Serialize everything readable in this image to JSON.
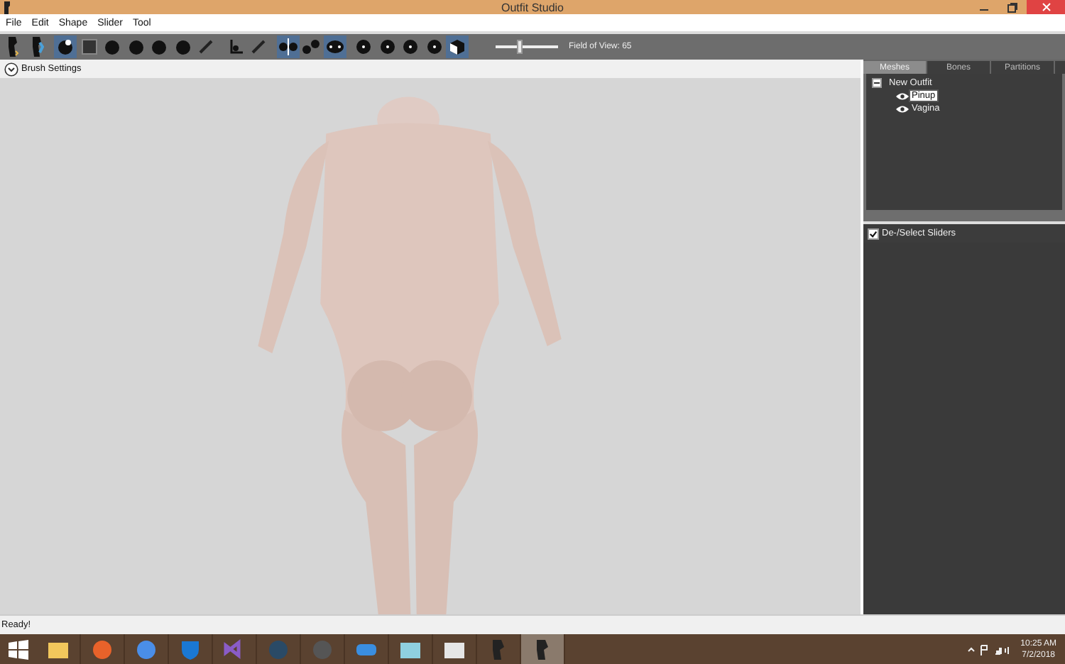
{
  "window": {
    "title": "Outfit Studio"
  },
  "menu": [
    "File",
    "Edit",
    "Shape",
    "Slider",
    "Tool"
  ],
  "toolbar": {
    "tools": [
      {
        "kind": "figure",
        "selected": false
      },
      {
        "kind": "figure",
        "selected": false
      },
      {
        "kind": "sphere",
        "selected": true
      },
      {
        "kind": "square",
        "selected": false
      },
      {
        "kind": "sphere",
        "selected": false
      },
      {
        "kind": "sphere",
        "selected": false
      },
      {
        "kind": "sphere",
        "selected": false
      },
      {
        "kind": "sphere",
        "selected": false
      },
      {
        "kind": "pen",
        "selected": false
      },
      {
        "kind": "axes",
        "selected": false
      },
      {
        "kind": "pen",
        "selected": false
      },
      {
        "kind": "mirror",
        "selected": true
      },
      {
        "kind": "dots",
        "selected": false
      },
      {
        "kind": "dots",
        "selected": true
      },
      {
        "kind": "dot",
        "selected": false
      },
      {
        "kind": "dot",
        "selected": false
      },
      {
        "kind": "dot",
        "selected": false
      },
      {
        "kind": "dot",
        "selected": false
      },
      {
        "kind": "cube",
        "selected": true
      }
    ],
    "fov_slider": {
      "level": 0.4
    },
    "fov_label": "Field of View: 65"
  },
  "brush_settings": {
    "label": "Brush Settings",
    "expanded": false
  },
  "panel": {
    "tabs": [
      {
        "label": "Meshes",
        "selected": true
      },
      {
        "label": "Bones",
        "selected": false
      },
      {
        "label": "Partitions",
        "selected": false
      }
    ],
    "tree": {
      "label": "New Outfit",
      "children": [
        {
          "label": "Pinup",
          "selected": true
        },
        {
          "label": "Vagina",
          "selected": false
        }
      ]
    },
    "sliders_toggle": {
      "label": "De-/Select Sliders",
      "checked": true
    }
  },
  "status_bar": "Ready!",
  "taskbar": {
    "apps": [
      {
        "selected": false
      },
      {
        "selected": false
      },
      {
        "selected": false
      },
      {
        "selected": false
      },
      {
        "selected": false
      },
      {
        "selected": false
      },
      {
        "selected": false
      },
      {
        "selected": false
      },
      {
        "selected": false
      },
      {
        "selected": false
      },
      {
        "selected": false
      },
      {
        "selected": true
      }
    ],
    "time": "10:25 AM",
    "date": "7/2/2018"
  }
}
